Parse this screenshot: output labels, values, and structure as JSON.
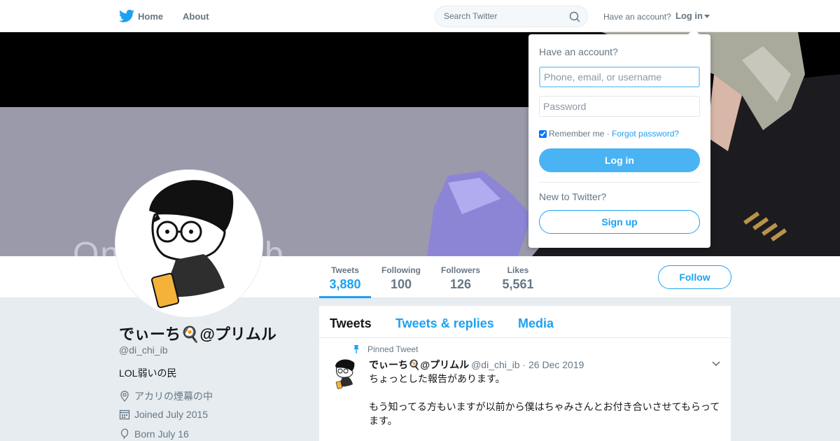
{
  "nav": {
    "home_label": "Home",
    "about_label": "About",
    "search_placeholder": "Search Twitter",
    "have_account": "Have an account?",
    "login_label": "Log in"
  },
  "banner": {
    "overlay_text": "Oni  chi  chi ib"
  },
  "profile": {
    "name": "でぃーち🍳@プリムル",
    "handle": "@di_chi_ib",
    "bio": "LOL弱いの民",
    "location": "アカリの煙幕の中",
    "joined": "Joined July 2015",
    "born": "Born July 16"
  },
  "stats": [
    {
      "label": "Tweets",
      "value": "3,880"
    },
    {
      "label": "Following",
      "value": "100"
    },
    {
      "label": "Followers",
      "value": "126"
    },
    {
      "label": "Likes",
      "value": "5,561"
    }
  ],
  "follow_label": "Follow",
  "timeline": {
    "tabs": [
      "Tweets",
      "Tweets & replies",
      "Media"
    ],
    "pinned_label": "Pinned Tweet",
    "tweet": {
      "name": "でぃーち🍳@プリムル",
      "handle": "@di_chi_ib",
      "date": "· 26 Dec 2019",
      "text_line1": "ちょっとした報告があります。",
      "text_line2": "もう知ってる方もいますが以前から僕はちゃみさんとお付き合いさせてもらってます。"
    }
  },
  "login_dropdown": {
    "title": "Have an account?",
    "username_placeholder": "Phone, email, or username",
    "password_placeholder": "Password",
    "remember_label": "Remember me",
    "separator": " · ",
    "forgot_label": "Forgot password?",
    "login_button": "Log in",
    "new_label": "New to Twitter?",
    "signup_button": "Sign up"
  },
  "colors": {
    "accent": "#1da1f2",
    "login_button": "#4ab3f4",
    "background": "#e6ecf0"
  }
}
